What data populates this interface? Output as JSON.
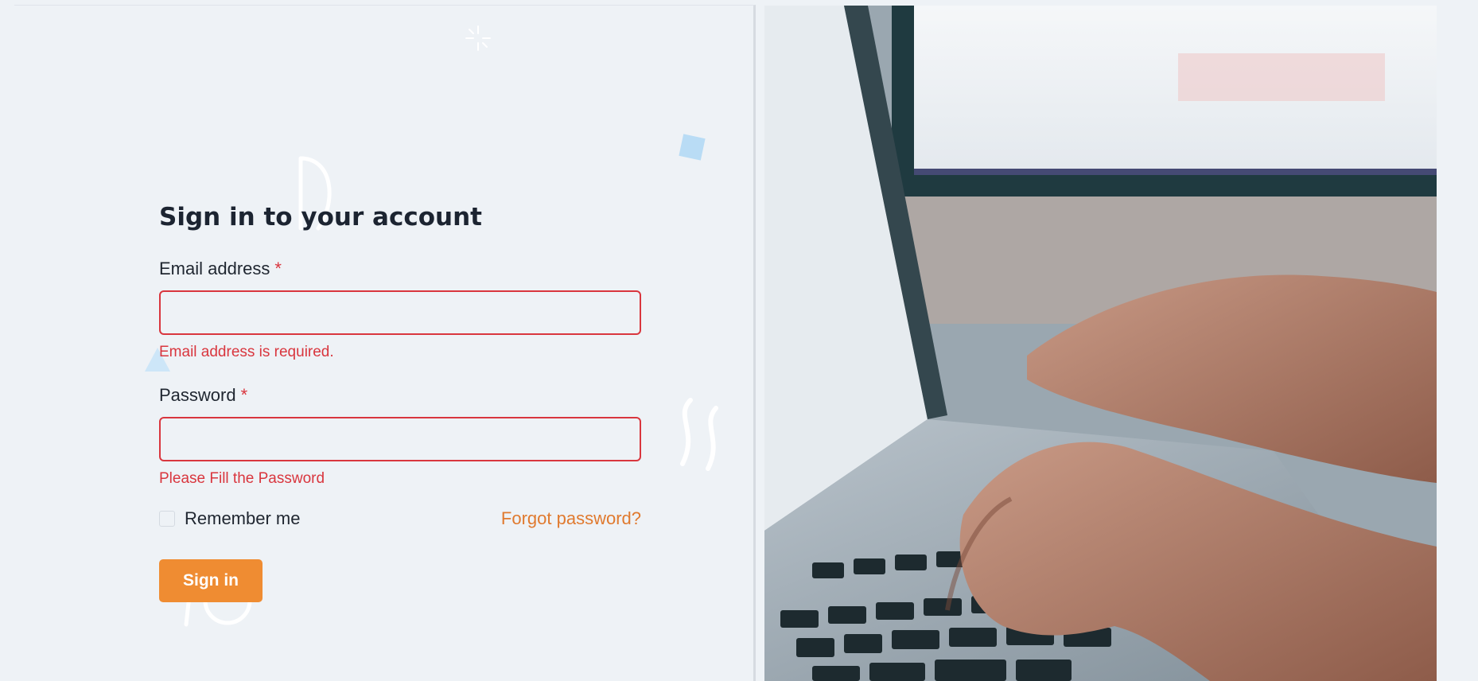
{
  "form": {
    "title": "Sign in to your account",
    "email": {
      "label": "Email address",
      "required_mark": "*",
      "value": "",
      "error": "Email address is required."
    },
    "password": {
      "label": "Password",
      "required_mark": "*",
      "value": "",
      "error": "Please Fill the Password"
    },
    "remember_label": "Remember me",
    "remember_checked": false,
    "forgot_label": "Forgot password?",
    "submit_label": "Sign in"
  },
  "colors": {
    "error": "#d9363e",
    "accent": "#ef8c32",
    "link": "#e07a2f",
    "background": "#eef2f6"
  },
  "hero_image": "laptop-typing-photo"
}
